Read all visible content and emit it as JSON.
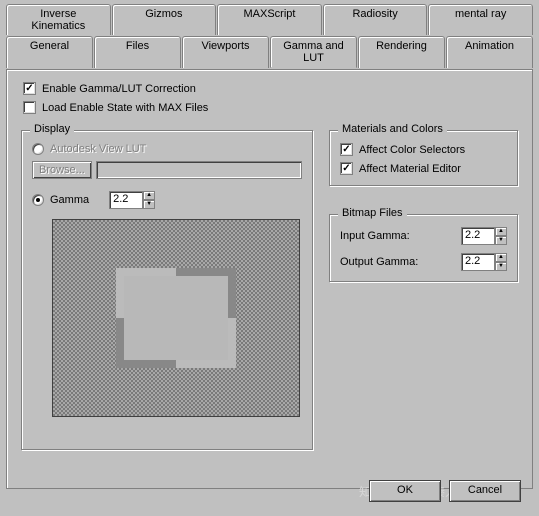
{
  "tabs_row1": [
    "Inverse Kinematics",
    "Gizmos",
    "MAXScript",
    "Radiosity",
    "mental ray"
  ],
  "tabs_row2": [
    "General",
    "Files",
    "Viewports",
    "Gamma and LUT",
    "Rendering",
    "Animation"
  ],
  "active_tab": "Gamma and LUT",
  "enable_gamma": {
    "label": "Enable Gamma/LUT Correction",
    "checked": true
  },
  "load_state": {
    "label": "Load Enable State with MAX Files",
    "checked": false
  },
  "display": {
    "title": "Display",
    "autodesk_lut": {
      "label": "Autodesk View LUT",
      "selected": false
    },
    "browse_label": "Browse...",
    "gamma": {
      "label": "Gamma",
      "selected": true,
      "value": "2.2"
    }
  },
  "materials": {
    "title": "Materials and Colors",
    "affect_selectors": {
      "label": "Affect Color Selectors",
      "checked": true
    },
    "affect_editor": {
      "label": "Affect Material Editor",
      "checked": true
    }
  },
  "bitmap": {
    "title": "Bitmap Files",
    "input_label": "Input Gamma:",
    "input_value": "2.2",
    "output_label": "Output Gamma:",
    "output_value": "2.2"
  },
  "buttons": {
    "ok": "OK",
    "cancel": "Cancel"
  },
  "watermark": "@在人间凑人数",
  "watermark2": "知乎"
}
